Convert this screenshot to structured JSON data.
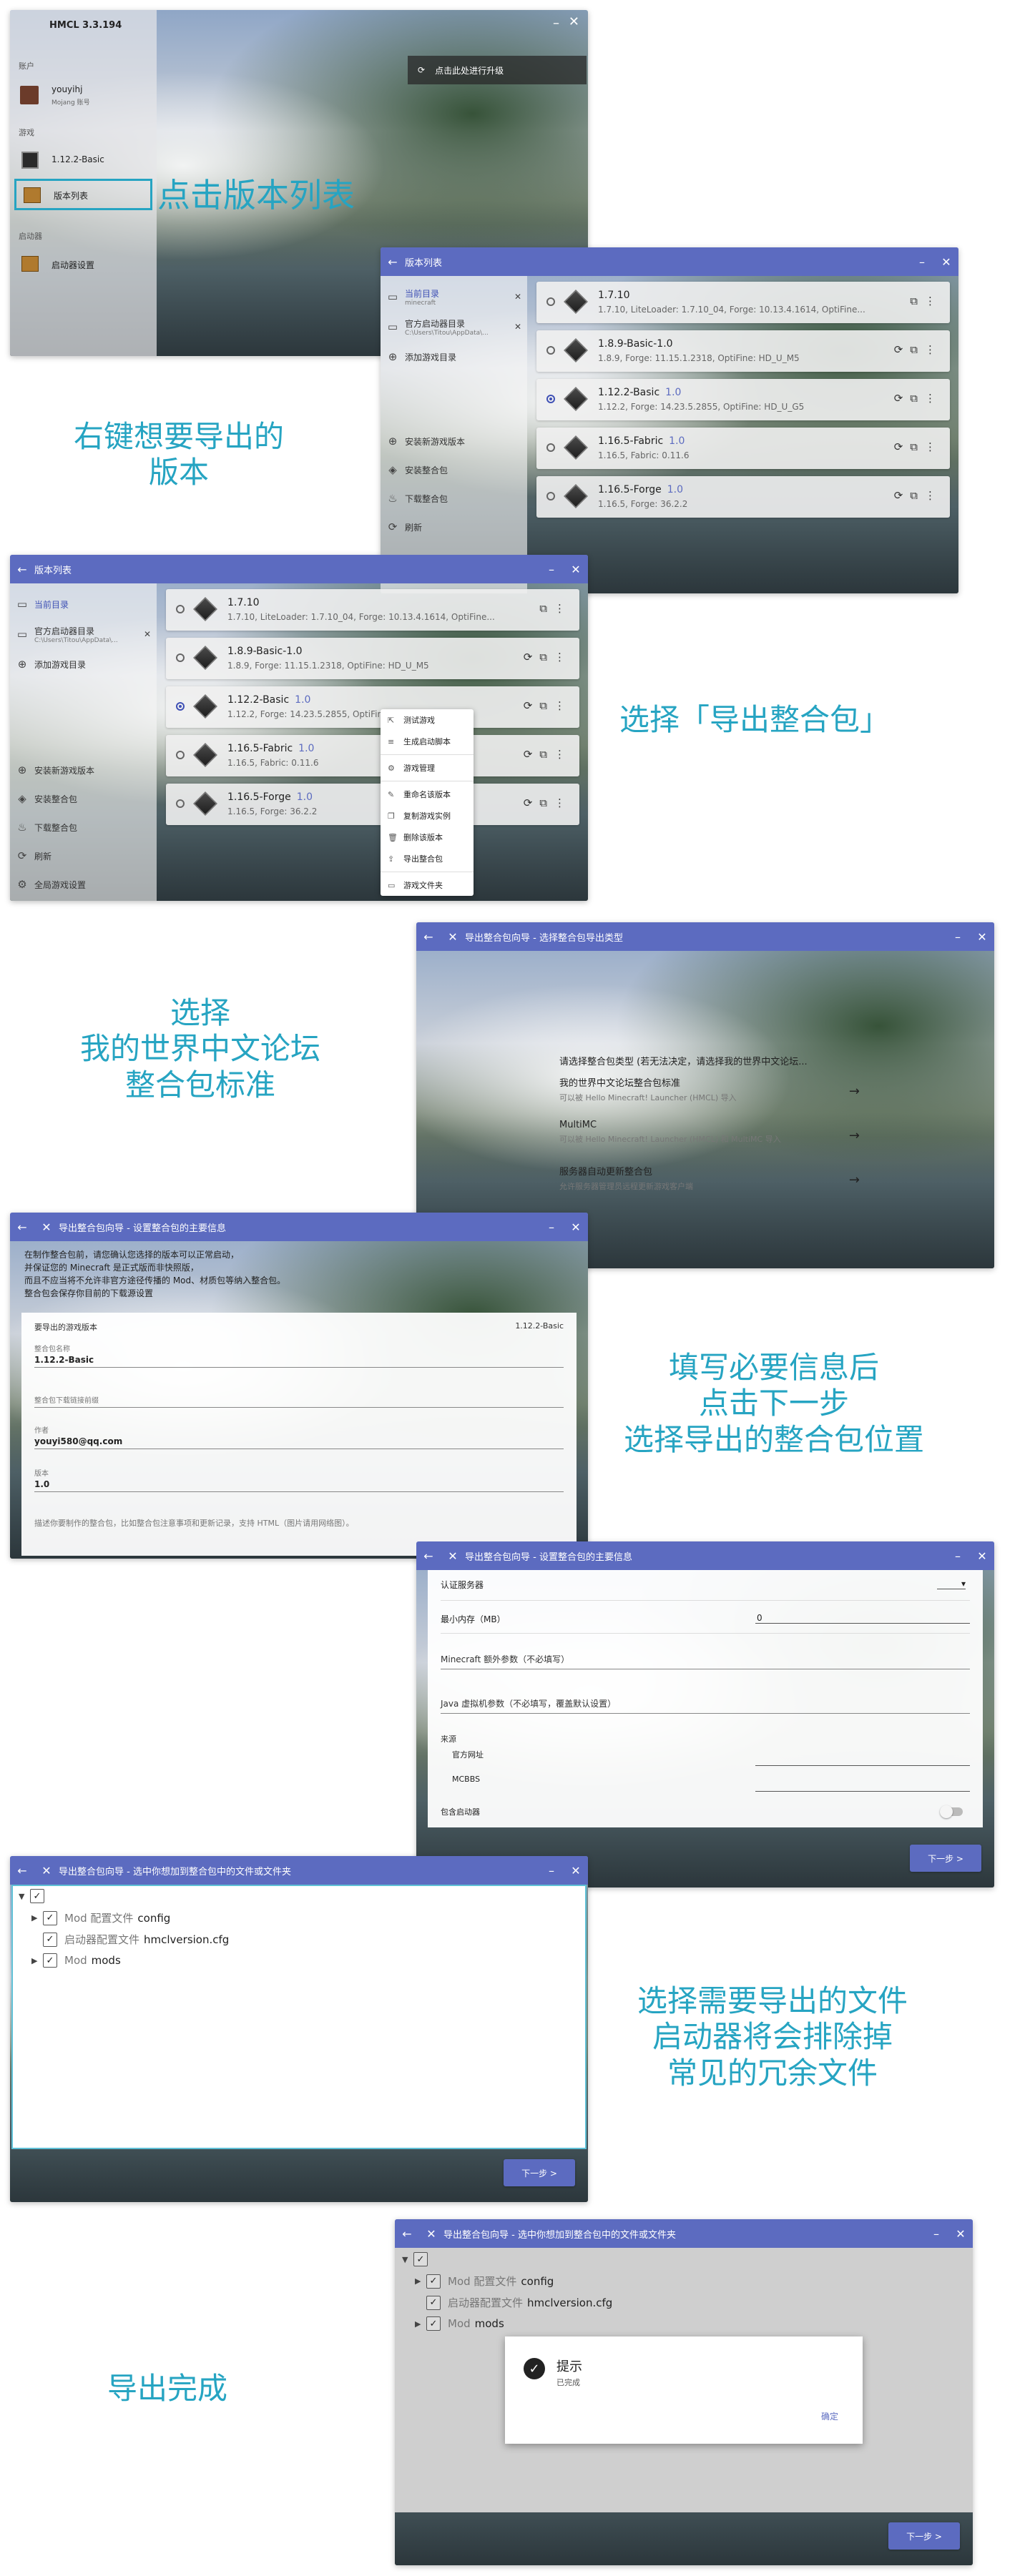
{
  "captions": {
    "c1": "点击版本列表",
    "c2_line1": "右键想要导出的",
    "c2_line2": "版本",
    "c3": "选择「导出整合包」",
    "c4_line1": "选择",
    "c4_line2": "我的世界中文论坛",
    "c4_line3": "整合包标准",
    "c5_line1": "填写必要信息后",
    "c5_line2": "点击下一步",
    "c5_line3": "选择导出的整合包位置",
    "c6_line1": "选择需要导出的文件",
    "c6_line2": "启动器将会排除掉",
    "c6_line3": "常见的冗余文件",
    "c7": "导出完成"
  },
  "main": {
    "title": "HMCL 3.3.194",
    "account_section": "账户",
    "username": "youyihj",
    "account_type": "Mojang 账号",
    "game_section": "游戏",
    "current_game": "1.12.2-Basic",
    "version_list": "版本列表",
    "launcher_section": "启动器",
    "launcher_settings": "启动器设置",
    "upgrade": "点击此处进行升级"
  },
  "versions_window": {
    "title": "版本列表",
    "current_dir": "当前目录",
    "current_dir_sub": "minecraft",
    "official_dir": "官方启动器目录",
    "official_dir_sub": "C:\\Users\\Titou\\AppData\\...",
    "add_dir": "添加游戏目录",
    "install_new": "安装新游戏版本",
    "install_modpack": "安装整合包",
    "download_modpack": "下载整合包",
    "refresh": "刷新",
    "global_settings": "全局游戏设置",
    "items": [
      {
        "name": "1.7.10",
        "tag": "",
        "desc": "1.7.10, LiteLoader: 1.7.10_04, Forge: 10.13.4.1614, OptiFine..."
      },
      {
        "name": "1.8.9-Basic-1.0",
        "tag": "",
        "desc": "1.8.9, Forge: 11.15.1.2318, OptiFine: HD_U_M5"
      },
      {
        "name": "1.12.2-Basic",
        "tag": "1.0",
        "desc": "1.12.2, Forge: 14.23.5.2855, OptiFine: HD_U_G5"
      },
      {
        "name": "1.16.5-Fabric",
        "tag": "1.0",
        "desc": "1.16.5, Fabric: 0.11.6"
      },
      {
        "name": "1.16.5-Forge",
        "tag": "1.0",
        "desc": "1.16.5, Forge: 36.2.2"
      }
    ]
  },
  "context_menu": {
    "items": [
      "测试游戏",
      "生成启动脚本",
      "游戏管理",
      "重命名该版本",
      "复制游戏实例",
      "删除该版本",
      "导出整合包",
      "游戏文件夹"
    ]
  },
  "type_window": {
    "title": "导出整合包向导 - 选择整合包导出类型",
    "prompt": "请选择整合包类型 (若无法决定，请选择我的世界中文论坛...",
    "options": [
      {
        "title": "我的世界中文论坛整合包标准",
        "desc": "可以被 Hello Minecraft! Launcher (HMCL) 导入"
      },
      {
        "title": "MultiMC",
        "desc": "可以被 Hello Minecraft! Launcher (HMCL) 和 MultiMC 导入"
      },
      {
        "title": "服务器自动更新整合包",
        "desc": "允许服务器管理员远程更新游戏客户端"
      }
    ]
  },
  "info_window": {
    "title": "导出整合包向导 - 设置整合包的主要信息",
    "notice_1": "在制作整合包前，请您确认您选择的版本可以正常启动，",
    "notice_2": "并保证您的 Minecraft 是正式版而非快照版，",
    "notice_3": "而且不应当将不允许非官方途径传播的 Mod、材质包等纳入整合包。",
    "notice_4": "整合包会保存你目前的下载源设置",
    "version_label": "要导出的游戏版本",
    "version_value": "1.12.2-Basic",
    "name_label": "整合包名称",
    "name_value": "1.12.2-Basic",
    "url_label": "整合包下载链接前缀",
    "author_label": "作者",
    "author_value": "youyi580@qq.com",
    "ver_label": "版本",
    "ver_value": "1.0",
    "desc_hint": "描述你要制作的整合包，比如整合包注意事项和更新记录，支持 HTML（图片请用网络图）。"
  },
  "settings_window": {
    "title": "导出整合包向导 - 设置整合包的主要信息",
    "auth_server": "认证服务器",
    "min_memory": "最小内存（MB）",
    "min_memory_value": "0",
    "mc_args": "Minecraft 额外参数（不必填写）",
    "jvm_args": "Java 虚拟机参数（不必填写，覆盖默认设置）",
    "source": "来源",
    "official_site": "官方网址",
    "mcbbs": "MCBBS",
    "include_launcher": "包含启动器",
    "next": "下一步 >"
  },
  "files_window": {
    "title": "导出整合包向导 - 选中你想加到整合包中的文件或文件夹",
    "rows": [
      {
        "dim": "Mod 配置文件",
        "name": "config"
      },
      {
        "dim": "启动器配置文件",
        "name": "hmclversion.cfg"
      },
      {
        "dim": "Mod",
        "name": "mods"
      }
    ],
    "next": "下一步 >"
  },
  "done_window": {
    "title": "导出整合包向导 - 选中你想加到整合包中的文件或文件夹",
    "dialog_title": "提示",
    "dialog_msg": "已完成",
    "dialog_ok": "确定",
    "next": "下一步 >"
  }
}
